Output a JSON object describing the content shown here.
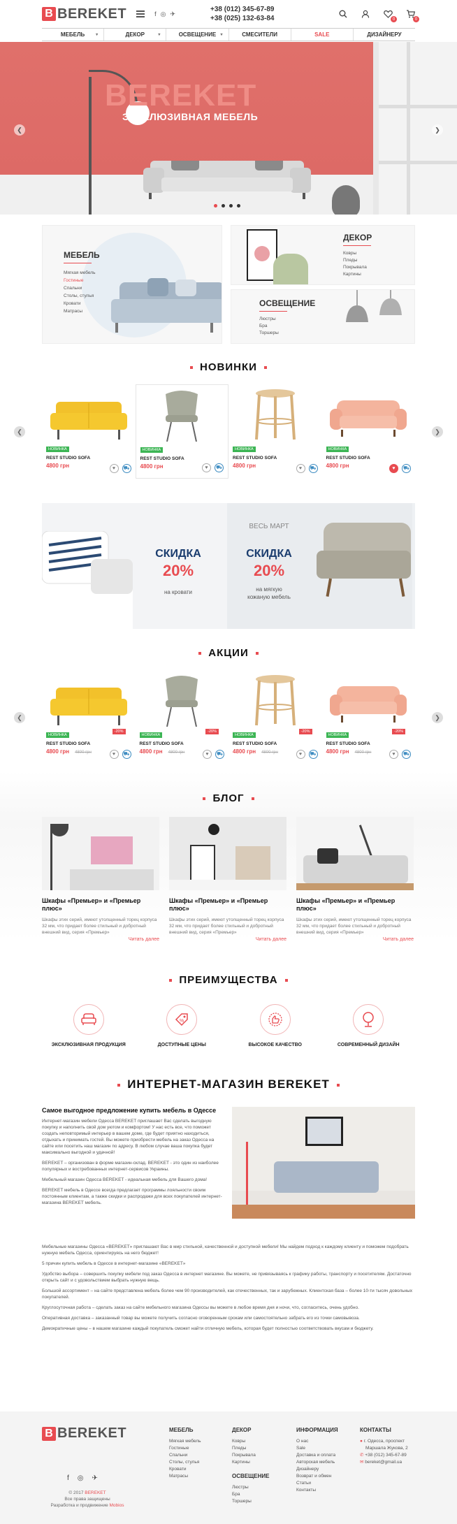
{
  "header": {
    "logo_letter": "B",
    "logo_text": "BEREKET",
    "socials": [
      "f",
      "◎",
      "✈"
    ],
    "phones": [
      "+38 (012) 345-67-89",
      "+38 (025) 132-63-84"
    ],
    "wishlist_count": "0",
    "cart_count": "0"
  },
  "nav": [
    {
      "label": "Мебель",
      "has_arrow": true
    },
    {
      "label": "Декор",
      "has_arrow": true
    },
    {
      "label": "Освещение",
      "has_arrow": true
    },
    {
      "label": "Смесители",
      "has_arrow": false
    },
    {
      "label": "Sale",
      "has_arrow": false
    },
    {
      "label": "Дизайнеру",
      "has_arrow": false
    }
  ],
  "hero": {
    "title": "BEREKET",
    "subtitle": "ЭКСКЛЮЗИВНАЯ МЕБЕЛЬ",
    "slides": 4,
    "active_slide": 1
  },
  "categories": {
    "furniture": {
      "title": "Мебель",
      "items": [
        "Мягкая мебель",
        "Гостиные",
        "Спальни",
        "Столы, стулья",
        "Кровати",
        "Матрасы"
      ],
      "active_index": 1
    },
    "decor": {
      "title": "Декор",
      "items": [
        "Ковры",
        "Пледы",
        "Покрывала",
        "Картины"
      ]
    },
    "lighting": {
      "title": "Освещение",
      "items": [
        "Люстры",
        "Бра",
        "Торшеры"
      ]
    }
  },
  "new": {
    "title": "НОВИНКИ",
    "products": [
      {
        "tag": "НОВИНКА",
        "name": "REST STUDIO SOFA",
        "price": "4800 грн",
        "kind": "sofa-yellow",
        "liked": false
      },
      {
        "tag": "НОВИНКА",
        "name": "REST STUDIO SOFA",
        "price": "4800 грн",
        "kind": "chair",
        "liked": false
      },
      {
        "tag": "НОВИНКА",
        "name": "REST STUDIO SOFA",
        "price": "4800 грн",
        "kind": "stool",
        "liked": false
      },
      {
        "tag": "НОВИНКА",
        "name": "REST STUDIO SOFA",
        "price": "4800 грн",
        "kind": "sofa-pink",
        "liked": true
      }
    ]
  },
  "promo": {
    "left_title": "СКИДКА",
    "left_pct": "20%",
    "left_note": "на кровати",
    "right_top": "ВЕСЬ МАРТ",
    "right_title": "СКИДКА",
    "right_pct": "20%",
    "right_note_1": "на мягкую",
    "right_note_2": "кожаную мебель"
  },
  "sale": {
    "title": "АКЦИИ",
    "products": [
      {
        "tag": "НОВИНКА",
        "discount": "-20%",
        "name": "REST STUDIO SOFA",
        "price": "4800 грн",
        "old": "4800 грн",
        "kind": "sofa-yellow"
      },
      {
        "tag": "НОВИНКА",
        "discount": "-20%",
        "name": "REST STUDIO SOFA",
        "price": "4800 грн",
        "old": "4800 грн",
        "kind": "chair"
      },
      {
        "tag": "НОВИНКА",
        "discount": "-20%",
        "name": "REST STUDIO SOFA",
        "price": "4800 грн",
        "old": "4800 грн",
        "kind": "stool"
      },
      {
        "tag": "НОВИНКА",
        "discount": "-20%",
        "name": "REST STUDIO SOFA",
        "price": "4800 грн",
        "old": "4800 грн",
        "kind": "sofa-pink"
      }
    ]
  },
  "blog": {
    "title": "БЛОГ",
    "posts": [
      {
        "title": "Шкафы «Премьер» и «Премьер плюс»",
        "text": "Шкафы этих серий, имеют утолщенный торец корпуса 32 мм, что придает более стильный и добротный внешний вид, серия «Премьер»",
        "more": "Читать далее"
      },
      {
        "title": "Шкафы «Премьер» и «Премьер плюс»",
        "text": "Шкафы этих серий, имеют утолщенный торец корпуса 32 мм, что придает более стильный и добротный внешний вид, серия «Премьер»",
        "more": "Читать далее"
      },
      {
        "title": "Шкафы «Премьер» и «Премьер плюс»",
        "text": "Шкафы этих серий, имеют утолщенный торец корпуса 32 мм, что придает более стильный и добротный внешний вид, серия «Премьер»",
        "more": "Читать далее"
      }
    ]
  },
  "advantages": {
    "title": "ПРЕИМУЩЕСТВА",
    "items": [
      {
        "label": "ЭКСКЛЮЗИВНАЯ ПРОДУКЦИЯ",
        "icon": "armchair-icon"
      },
      {
        "label": "ДОСТУПНЫЕ ЦЕНЫ",
        "icon": "price-tag-icon"
      },
      {
        "label": "ВЫСОКОЕ КАЧЕСТВО",
        "icon": "thumbs-up-icon"
      },
      {
        "label": "СОВРЕМЕННЫЙ ДИЗАЙН",
        "icon": "chair-design-icon"
      }
    ]
  },
  "about": {
    "title": "ИНТЕРНЕТ-МАГАЗИН BEREKET",
    "heading": "Самое выгодное предложение купить мебель в Одессе",
    "paragraphs_left": [
      "Интернет-магазин мебели Одесса BEREKET приглашает Вас сделать выгодную покупку и наполнить свой дом уютом и комфортом! У нас есть все, что поможет создать неповторимый интерьер в вашем доме, где будет приятно находиться, отдыхать и принимать гостей. Вы можете приобрести мебель на заказ Одесса на сайте или посетить наш магазин по адресу. В любом случае ваша покупка будет максимально выгодной и удачной!",
      "BEREKET – организован в форме магазин-склад. BEREKET - это один из наиболее популярных и востребованных интернет-сервисов Украины.",
      "Мебельный магазин Одесса BEREKET - идеальная мебель для Вашего дома!",
      "BEREKET мебель в Одессе всегда предлагает программы лояльности своим постоянным клиентам, а также скидки и распродажи для всех покупателей интернет-магазина BEREKET мебель."
    ],
    "paragraphs_full": [
      "Мебельные магазины Одесса «BEREKET» приглашают Вас в мир стильной, качественной и доступной мебели! Мы найдем подход к каждому клиенту и поможем подобрать нужную мебель Одесса, ориентируясь на него бюджет!",
      "5 причин купить мебель в Одессе в интернет-магазине «BEREKET»",
      "Удобство выбора – совершить покупку мебели под заказ Одесса в интернет магазине. Вы можете, не привязываясь к графику работы, транспорту и посетителям. Достаточно открыть сайт и с удовольствием выбрать нужную вещь.",
      "Большой ассортимент – на сайте представлена мебель более чем 90 производителей, как отечественных, так и зарубежных. Клиентская база – более 10-ти тысяч довольных покупателей.",
      "Круглосуточная работа – сделать заказ на сайте мебельного магазина Одессы вы можете в любое время дня и ночи, что, согласитесь, очень удобно.",
      "Оперативная доставка – заказанный товар вы можете получить согласно оговоренным срокам или самостоятельно забрать его из точки самовывоза.",
      "Демократичные цены – в нашем магазине каждый покупатель сможет найти отличную мебель, которая будет полностью соответствовать вкусам и бюджету."
    ]
  },
  "footer": {
    "logo_letter": "B",
    "logo_text": "BEREKET",
    "copyright": "© 2017",
    "copyright_brand": "BEREKET",
    "rights": "Все права защищены",
    "dev": "Разработка и продвижение",
    "dev_brand": "Mobios",
    "col_furniture": {
      "title": "Мебель",
      "items": [
        "Мягкая мебель",
        "Гостиные",
        "Спальни",
        "Столы, стулья",
        "Кровати",
        "Матрасы"
      ]
    },
    "col_decor": {
      "title": "Декор",
      "items": [
        "Ковры",
        "Пледы",
        "Покрывала",
        "Картины"
      ]
    },
    "col_lighting": {
      "title": "Освещение",
      "items": [
        "Люстры",
        "Бра",
        "Торшеры"
      ]
    },
    "col_info": {
      "title": "Информация",
      "items": [
        "О нас",
        "Sale",
        "Доставка и оплата",
        "Авторская мебель",
        "Дизайнеру",
        "Возврат и обмен",
        "Статьи",
        "Контакты"
      ]
    },
    "col_contacts": {
      "title": "Контакты",
      "address_1": "г. Одесса, проспект",
      "address_2": "Маршала Жукова, 2",
      "phone": "+38 (012) 345-67-89",
      "email": "bereket@gmail.ua"
    }
  },
  "colors": {
    "accent": "#e84b50",
    "new_tag": "#3cb554",
    "navy": "#1a3c6e"
  }
}
